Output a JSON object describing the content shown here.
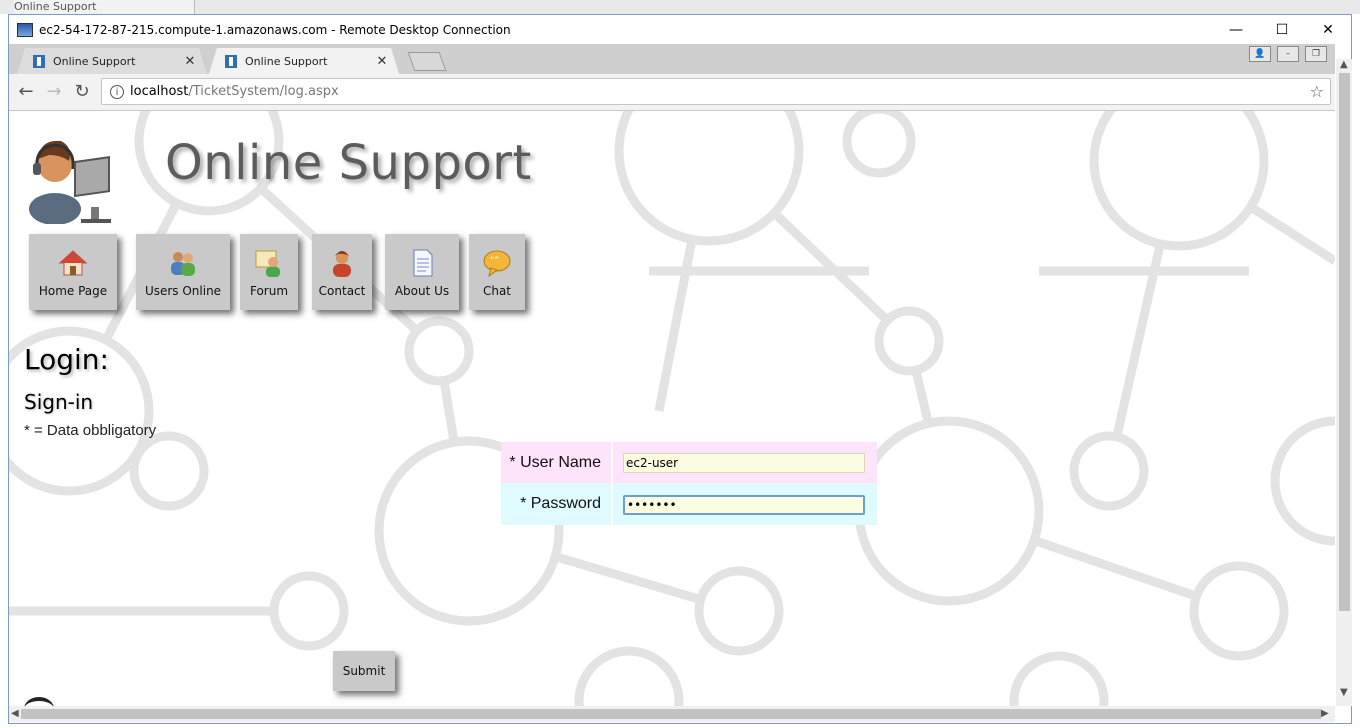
{
  "background_tab": {
    "label": "Online Support"
  },
  "rdp": {
    "title": "ec2-54-172-87-215.compute-1.amazonaws.com - Remote Desktop Connection",
    "minimize": "—",
    "maximize": "☐",
    "close": "✕"
  },
  "browser": {
    "tabs": [
      {
        "label": "Online Support",
        "active": false
      },
      {
        "label": "Online Support",
        "active": true
      }
    ],
    "tab_close": "✕",
    "url_host": "localhost",
    "url_path": "/TicketSystem/log.aspx",
    "back": "←",
    "forward": "→",
    "reload": "↻",
    "star": "☆",
    "info": "i"
  },
  "site": {
    "title": "Online Support",
    "menu": [
      {
        "label": "Home Page",
        "icon": "home-icon"
      },
      {
        "label": "Users Online",
        "icon": "users-icon"
      },
      {
        "label": "Forum",
        "icon": "forum-icon"
      },
      {
        "label": "Contact",
        "icon": "contact-icon"
      },
      {
        "label": "About Us",
        "icon": "document-icon"
      },
      {
        "label": "Chat",
        "icon": "chat-bubble-icon"
      }
    ],
    "login_heading": "Login:",
    "signin_heading": "Sign-in",
    "required_note": "* = Data obbligatory",
    "form": {
      "username_label": "* User Name",
      "username_value": "ec2-user",
      "password_label": "* Password",
      "password_value": "•••••••"
    },
    "submit_label": "Submit"
  },
  "colors": {
    "username_row": "#fde4fb",
    "password_row": "#e0fbfd",
    "input_bg": "#fcfde0",
    "menu_button": "#c9c9c9"
  }
}
